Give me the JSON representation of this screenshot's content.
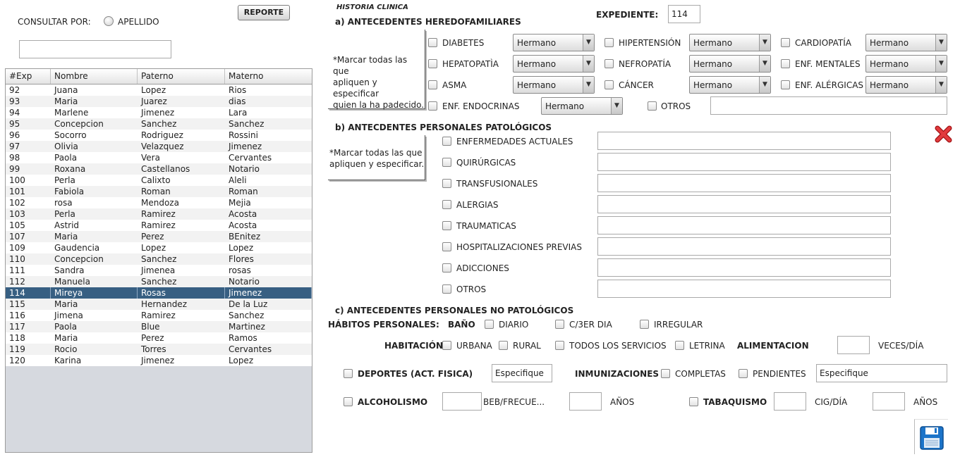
{
  "consult": {
    "label": "CONSULTAR POR:",
    "radio_label": "APELLIDO",
    "search_value": "",
    "report_button": "REPORTE"
  },
  "table": {
    "headers": [
      "#Exp",
      "Nombre",
      "Paterno",
      "Materno"
    ],
    "selected_exp": "114",
    "rows": [
      [
        "92",
        "Juana",
        "Lopez",
        "Rios"
      ],
      [
        "93",
        "Maria",
        "Juarez",
        "dias"
      ],
      [
        "94",
        "Marlene",
        "Jimenez",
        "Lara"
      ],
      [
        "95",
        "Concepcion",
        "Sanchez",
        "Sanchez"
      ],
      [
        "96",
        "Socorro",
        "Rodriguez",
        "Rossini"
      ],
      [
        "97",
        "Olivia",
        "Velazquez",
        "Jimenez"
      ],
      [
        "98",
        "Paola",
        "Vera",
        "Cervantes"
      ],
      [
        "99",
        "Roxana",
        "Castellanos",
        "Notario"
      ],
      [
        "100",
        "Perla",
        "Calixto",
        "Aleli"
      ],
      [
        "101",
        "Fabiola",
        "Roman",
        "Roman"
      ],
      [
        "102",
        "rosa",
        "Mendoza",
        "Mejia"
      ],
      [
        "103",
        "Perla",
        "Ramirez",
        "Acosta"
      ],
      [
        "105",
        "Astrid",
        "Ramirez",
        "Acosta"
      ],
      [
        "107",
        "Maria",
        "Perez",
        "BEnitez"
      ],
      [
        "109",
        "Gaudencia",
        "Lopez",
        "Lopez"
      ],
      [
        "110",
        "Concepcion",
        "Sanchez",
        "Flores"
      ],
      [
        "111",
        "Sandra",
        "Jimenea",
        "rosas"
      ],
      [
        "112",
        "Manuela",
        "Sanchez",
        "Notario"
      ],
      [
        "114",
        "Mireya",
        "Rosas",
        "Jimenez"
      ],
      [
        "115",
        "Maria",
        "Hernandez",
        "De la Luz"
      ],
      [
        "116",
        "Jimena",
        "Ramirez",
        "Sanchez"
      ],
      [
        "117",
        "Paola",
        "Blue",
        "Martinez"
      ],
      [
        "118",
        "Maria",
        "Perez",
        "Ramos"
      ],
      [
        "119",
        "Rocio",
        "Torres",
        "Cervantes"
      ],
      [
        "120",
        "Karina",
        "Jimenez",
        "Lopez"
      ]
    ]
  },
  "header": {
    "title": "HISTORIA CLINICA",
    "expediente_label": "EXPEDIENTE:",
    "expediente_value": "114"
  },
  "heredo": {
    "title": "a) ANTECEDENTES HEREDOFAMILIARES",
    "note": [
      "*Marcar todas las que",
      "apliquen y especificar",
      "quien la ha padecido."
    ],
    "items": [
      {
        "label": "DIABETES",
        "value": "Hermano"
      },
      {
        "label": "HIPERTENSIÓN",
        "value": "Hermano"
      },
      {
        "label": "CARDIOPATÍA",
        "value": "Hermano"
      },
      {
        "label": "HEPATOPATÌA",
        "value": "Hermano"
      },
      {
        "label": "NEFROPATÍA",
        "value": "Hermano"
      },
      {
        "label": "ENF. MENTALES",
        "value": "Hermano"
      },
      {
        "label": "ASMA",
        "value": "Hermano"
      },
      {
        "label": "CÁNCER",
        "value": "Hermano"
      },
      {
        "label": "ENF. ALÉRGICAS",
        "value": "Hermano"
      },
      {
        "label": "ENF. ENDOCRINAS",
        "value": "Hermano"
      }
    ],
    "otros_label": "OTROS",
    "otros_value": ""
  },
  "patologicos": {
    "title": "b) ANTECDENTES PERSONALES PATOLÓGICOS",
    "note": [
      "*Marcar todas las que",
      "apliquen y especificar."
    ],
    "items": [
      {
        "label": "ENFERMEDADES ACTUALES",
        "value": ""
      },
      {
        "label": "QUIRÚRGICAS",
        "value": ""
      },
      {
        "label": "TRANSFUSIONALES",
        "value": ""
      },
      {
        "label": "ALERGIAS",
        "value": ""
      },
      {
        "label": "TRAUMATICAS",
        "value": ""
      },
      {
        "label": "HOSPITALIZACIONES PREVIAS",
        "value": ""
      },
      {
        "label": "ADICCIONES",
        "value": ""
      },
      {
        "label": "OTROS",
        "value": ""
      }
    ]
  },
  "no_patologicos": {
    "title": "c) ANTECEDENTES PERSONALES NO PATOLÓGICOS",
    "habitos_label": "HÁBITOS PERSONALES:",
    "bano_label": "BAÑO",
    "bano_options": [
      "DIARIO",
      "C/3ER DIA",
      "IRREGULAR"
    ],
    "habitacion_label": "HABITACIÓN",
    "habitacion_options": [
      "URBANA",
      "RURAL",
      "TODOS LOS SERVICIOS",
      "LETRINA"
    ],
    "alimentacion_label": "ALIMENTACION",
    "alimentacion_value": "",
    "veces_label": "VECES/DÍA",
    "deportes_label": "DEPORTES (ACT. FISICA)",
    "deportes_value": "Especifique",
    "inmunizaciones_label": "INMUNIZACIONES",
    "inmunizaciones_options": [
      "COMPLETAS",
      "PENDIENTES"
    ],
    "inmunizaciones_value": "Especifique",
    "alcoholismo_label": "ALCOHOLISMO",
    "alcoholismo_value": "",
    "beb_label": "BEB/FRECUE...",
    "alcohol_anos_value": "",
    "anos_label": "AÑOS",
    "tabaquismo_label": "TABAQUISMO",
    "tabaquismo_value": "",
    "cig_label": "CIG/DÍA",
    "tabaco_anos_value": "",
    "anos2_label": "AÑOS"
  },
  "icons": {
    "close": "close-icon",
    "save": "save-icon"
  },
  "colors": {
    "selected_row": "#375f82",
    "close_red": "#d8282c",
    "save_blue": "#1c74c9"
  }
}
